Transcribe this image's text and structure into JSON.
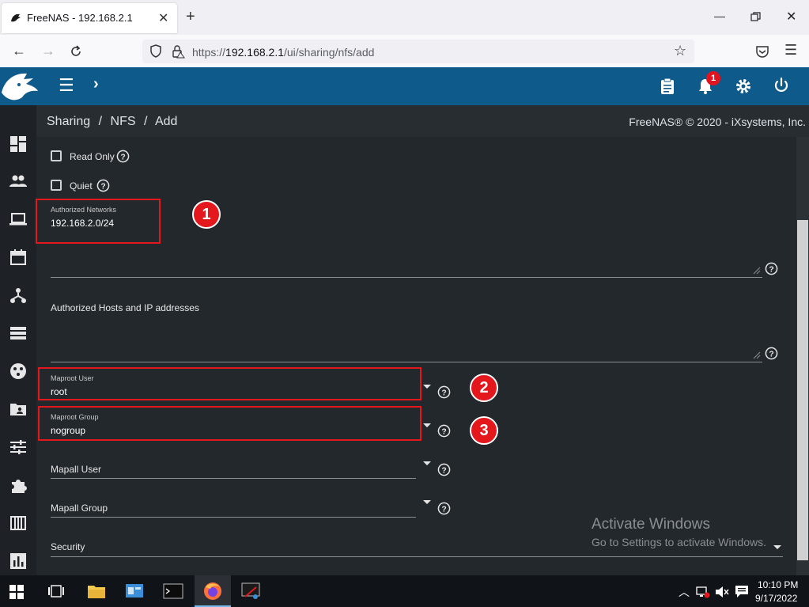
{
  "browser": {
    "tab_title": "FreeNAS - 192.168.2.1",
    "url_prefix": "https://",
    "url_host": "192.168.2.1",
    "url_path": "/ui/sharing/nfs/add"
  },
  "header": {
    "notification_count": "1"
  },
  "breadcrumb": {
    "items": [
      "Sharing",
      "NFS",
      "Add"
    ],
    "separator": "/"
  },
  "copyright": "FreeNAS® © 2020 - iXsystems, Inc.",
  "form": {
    "read_only_label": "Read Only",
    "quiet_label": "Quiet",
    "authorized_networks_label": "Authorized Networks",
    "authorized_networks_value": "192.168.2.0/24",
    "authorized_hosts_label": "Authorized Hosts and IP addresses",
    "maproot_user_label": "Maproot User",
    "maproot_user_value": "root",
    "maproot_group_label": "Maproot Group",
    "maproot_group_value": "nogroup",
    "mapall_user_label": "Mapall User",
    "mapall_group_label": "Mapall Group",
    "security_label": "Security"
  },
  "markers": [
    "1",
    "2",
    "3"
  ],
  "watermark": {
    "line1": "Activate Windows",
    "line2": "Go to Settings to activate Windows."
  },
  "taskbar": {
    "time": "10:10 PM",
    "date": "9/17/2022"
  },
  "colors": {
    "header_blue": "#0e5a8a",
    "annotation_red": "#e3171c",
    "badge_red": "#e0131f"
  }
}
